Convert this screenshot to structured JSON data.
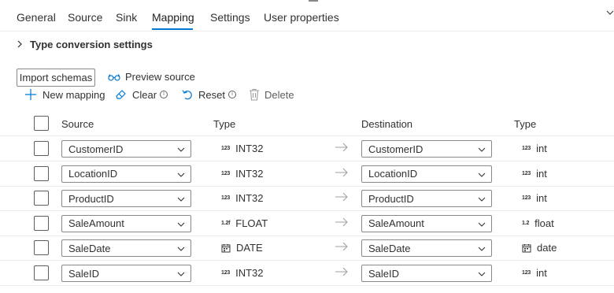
{
  "tabs": [
    {
      "label": "General"
    },
    {
      "label": "Source"
    },
    {
      "label": "Sink"
    },
    {
      "label": "Mapping"
    },
    {
      "label": "Settings"
    },
    {
      "label": "User properties"
    }
  ],
  "active_tab": "Mapping",
  "type_conversion": {
    "label": "Type conversion settings"
  },
  "actions": {
    "import_schemas": "Import schemas",
    "preview_source": "Preview source"
  },
  "toolbar": {
    "new_mapping": "New mapping",
    "clear": "Clear",
    "reset": "Reset",
    "delete": "Delete"
  },
  "table": {
    "headers": {
      "source": "Source",
      "source_type": "Type",
      "destination": "Destination",
      "destination_type": "Type"
    },
    "rows": [
      {
        "source": "CustomerID",
        "source_type_badge": "123",
        "source_type": "INT32",
        "destination": "CustomerID",
        "destination_type_badge": "123",
        "destination_type": "int"
      },
      {
        "source": "LocationID",
        "source_type_badge": "123",
        "source_type": "INT32",
        "destination": "LocationID",
        "destination_type_badge": "123",
        "destination_type": "int"
      },
      {
        "source": "ProductID",
        "source_type_badge": "123",
        "source_type": "INT32",
        "destination": "ProductID",
        "destination_type_badge": "123",
        "destination_type": "int"
      },
      {
        "source": "SaleAmount",
        "source_type_badge": "1.2f",
        "source_type": "FLOAT",
        "destination": "SaleAmount",
        "destination_type_badge": "1.2",
        "destination_type": "float"
      },
      {
        "source": "SaleDate",
        "source_type_badge": "calendar-icon",
        "source_type": "DATE",
        "destination": "SaleDate",
        "destination_type_badge": "calendar-icon",
        "destination_type": "date"
      },
      {
        "source": "SaleID",
        "source_type_badge": "123",
        "source_type": "INT32",
        "destination": "SaleID",
        "destination_type_badge": "123",
        "destination_type": "int"
      }
    ]
  },
  "colors": {
    "accent": "#0078d4",
    "text": "#323130",
    "border": "#8a8886",
    "divider": "#edebe9"
  }
}
